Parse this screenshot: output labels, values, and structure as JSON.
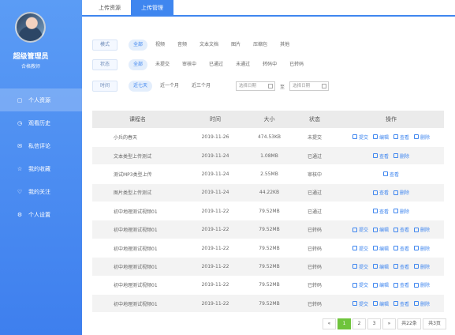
{
  "user": {
    "name": "超级管理员",
    "role": "合格教师"
  },
  "nav": [
    {
      "label": "个人资源",
      "icon": "folder-icon",
      "glyph": "▢",
      "active": true
    },
    {
      "label": "观看历史",
      "icon": "history-icon",
      "glyph": "◷",
      "active": false
    },
    {
      "label": "私信评论",
      "icon": "mail-icon",
      "glyph": "✉",
      "active": false
    },
    {
      "label": "我的收藏",
      "icon": "star-icon",
      "glyph": "☆",
      "active": false
    },
    {
      "label": "我的关注",
      "icon": "heart-icon",
      "glyph": "♡",
      "active": false
    },
    {
      "label": "个人设置",
      "icon": "gear-icon",
      "glyph": "⚙",
      "active": false
    }
  ],
  "tabs": [
    "上传资源",
    "上传管理"
  ],
  "filters": {
    "mode": {
      "label": "模式",
      "options": [
        "全部",
        "视频",
        "音频",
        "文本文档",
        "图片",
        "压缩包",
        "其他"
      ]
    },
    "status": {
      "label": "状态",
      "options": [
        "全部",
        "未提交",
        "审核中",
        "已通过",
        "未通过",
        "转码中",
        "已转码"
      ]
    },
    "time": {
      "label": "时间",
      "options": [
        "近七天",
        "近一个月",
        "近三个月"
      ],
      "start_placeholder": "选择日期",
      "to": "至",
      "end_placeholder": "选择日期"
    }
  },
  "table": {
    "headers": [
      "课程名",
      "时间",
      "大小",
      "状态",
      "操作"
    ],
    "rows": [
      {
        "name": "小兵的春天",
        "time": "2019-11-26",
        "size": "474.53KB",
        "status": "未提交",
        "ops": [
          "提交",
          "编辑",
          "查看",
          "删除"
        ]
      },
      {
        "name": "文本类型上传测试",
        "time": "2019-11-24",
        "size": "1.08MB",
        "status": "已通过",
        "ops": [
          "查看",
          "删除"
        ]
      },
      {
        "name": "测试MP3类型上传",
        "time": "2019-11-24",
        "size": "2.55MB",
        "status": "审核中",
        "ops": [
          "查看"
        ]
      },
      {
        "name": "图片类型上传测试",
        "time": "2019-11-24",
        "size": "44.22KB",
        "status": "已通过",
        "ops": [
          "查看",
          "删除"
        ]
      },
      {
        "name": "初中地理测试视频01",
        "time": "2019-11-22",
        "size": "79.52MB",
        "status": "已通过",
        "ops": [
          "查看",
          "删除"
        ]
      },
      {
        "name": "初中地理测试视频01",
        "time": "2019-11-22",
        "size": "79.52MB",
        "status": "已转码",
        "ops": [
          "提交",
          "编辑",
          "查看",
          "删除"
        ]
      },
      {
        "name": "初中地理测试视频01",
        "time": "2019-11-22",
        "size": "79.52MB",
        "status": "已转码",
        "ops": [
          "提交",
          "编辑",
          "查看",
          "删除"
        ]
      },
      {
        "name": "初中地理测试视频01",
        "time": "2019-11-22",
        "size": "79.52MB",
        "status": "已转码",
        "ops": [
          "提交",
          "编辑",
          "查看",
          "删除"
        ]
      },
      {
        "name": "初中地理测试视频01",
        "time": "2019-11-22",
        "size": "79.52MB",
        "status": "已转码",
        "ops": [
          "提交",
          "编辑",
          "查看",
          "删除"
        ]
      },
      {
        "name": "初中地理测试视频01",
        "time": "2019-11-22",
        "size": "79.52MB",
        "status": "已转码",
        "ops": [
          "提交",
          "编辑",
          "查看",
          "删除"
        ]
      }
    ]
  },
  "pagination": {
    "prev": "«",
    "pages": [
      "1",
      "2",
      "3"
    ],
    "current": "1",
    "next": "»",
    "total": "共22条",
    "page_count": "共3页"
  },
  "colors": {
    "primary": "#3f86ef",
    "sidebar": "#4a8cf2",
    "pager_active": "#6fc43c"
  }
}
